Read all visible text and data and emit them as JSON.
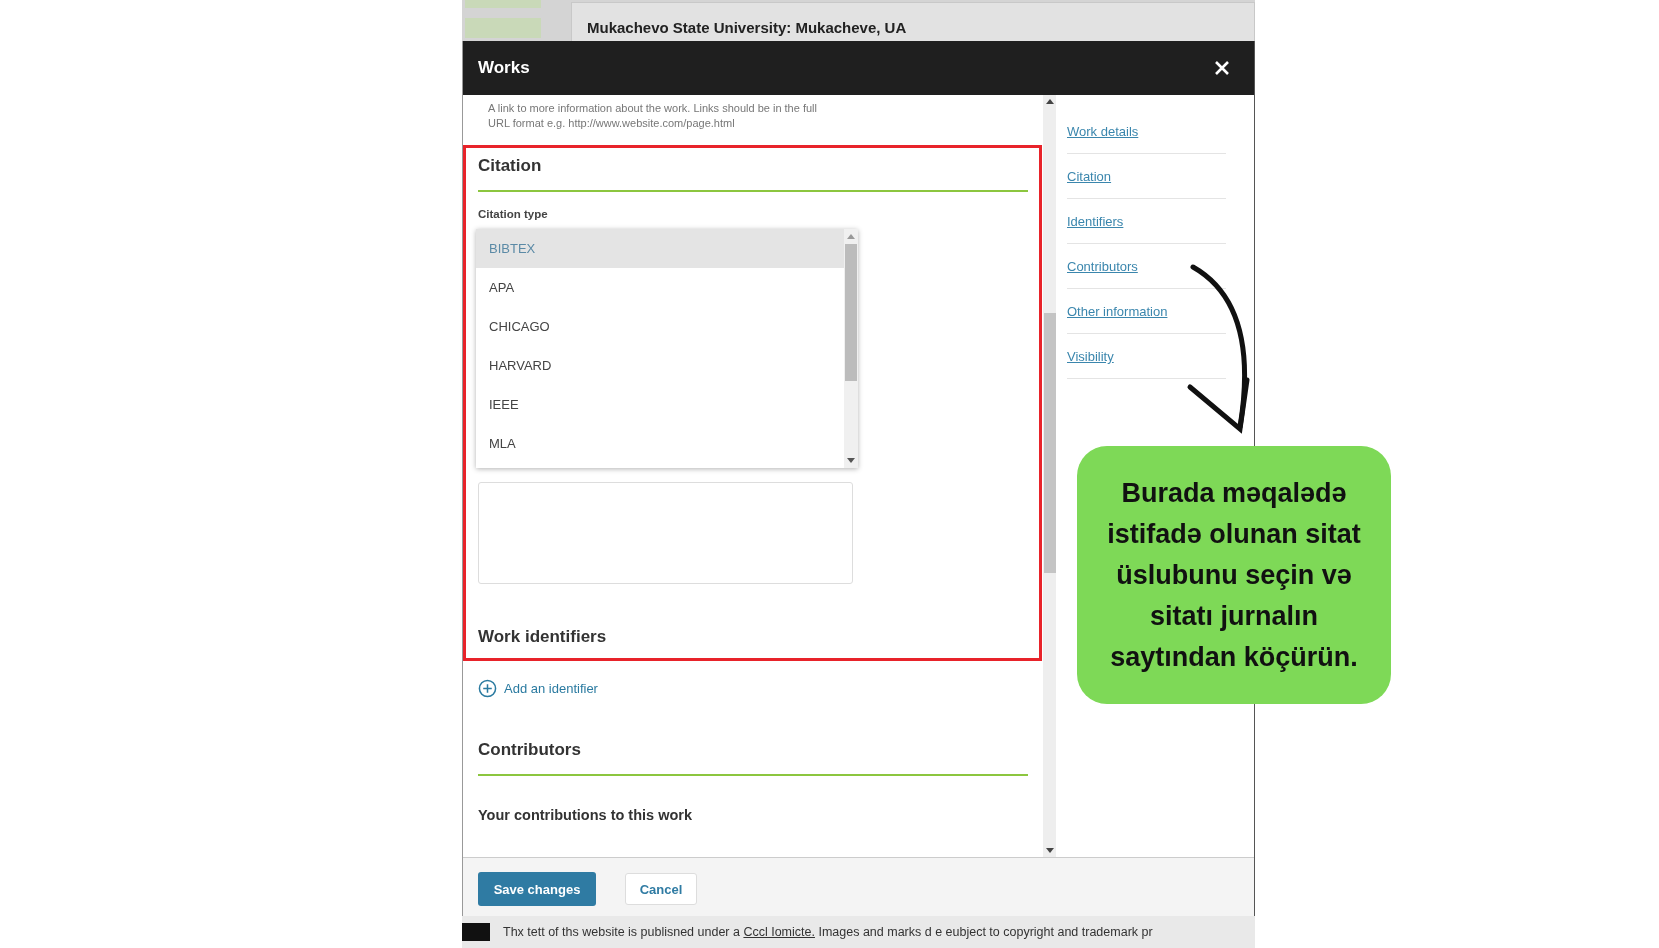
{
  "background_page": {
    "header": "Mukachevo State University: Mukacheve, UA",
    "footer": {
      "text_before": "Thx tett of ths website is publisned under a",
      "link": "Cccl Iomicte.",
      "text_after": "Images and marks d e eubject to copyright and trademark pr"
    }
  },
  "dialog": {
    "title": "Works",
    "url_hint": "A link to more information about the work. Links should be in the full URL format e.g. http://www.website.com/page.html",
    "citation": {
      "title": "Citation",
      "type_label": "Citation type",
      "options": [
        {
          "label": "BIBTEX",
          "selected": true
        },
        {
          "label": "APA",
          "selected": false
        },
        {
          "label": "CHICAGO",
          "selected": false
        },
        {
          "label": "HARVARD",
          "selected": false
        },
        {
          "label": "IEEE",
          "selected": false
        },
        {
          "label": "MLA",
          "selected": false
        }
      ]
    },
    "identifiers": {
      "title": "Work identifiers",
      "add_link": "Add an identifier"
    },
    "contributors": {
      "title": "Contributors",
      "subtitle": "Your contributions to this work"
    },
    "nav": [
      {
        "label": "Work details"
      },
      {
        "label": "Citation"
      },
      {
        "label": "Identifiers"
      },
      {
        "label": "Contributors"
      },
      {
        "label": "Other information"
      },
      {
        "label": "Visibility"
      }
    ],
    "buttons": {
      "save": "Save changes",
      "cancel": "Cancel"
    }
  },
  "callout": {
    "text": "Burada məqalədə istifadə olunan sitat üslubunu seçin və sitatı jurnalın saytından köçürün."
  }
}
